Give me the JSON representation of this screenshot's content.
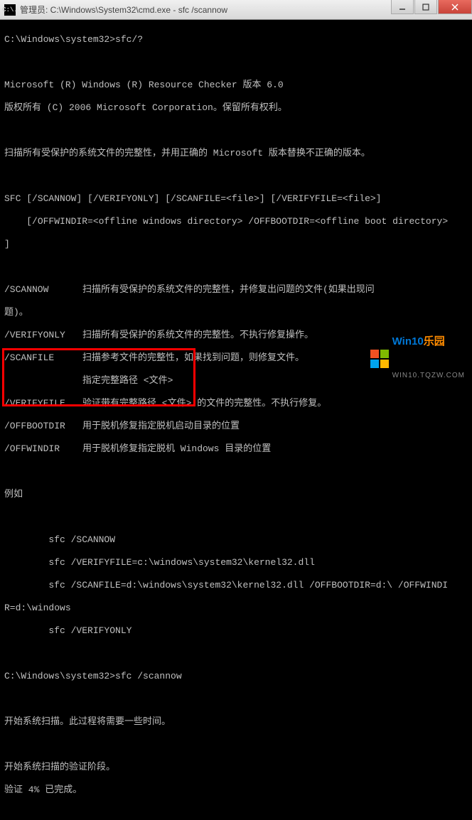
{
  "titlebar": {
    "icon_text": "C:\\.",
    "title": "管理员: C:\\Windows\\System32\\cmd.exe - sfc  /scannow"
  },
  "console": {
    "prompt1": "C:\\Windows\\system32>sfc/?",
    "blank": "",
    "ver_line": "Microsoft (R) Windows (R) Resource Checker 版本 6.0",
    "copyright": "版权所有 (C) 2006 Microsoft Corporation。保留所有权利。",
    "desc1": "扫描所有受保护的系统文件的完整性，并用正确的 Microsoft 版本替换不正确的版本。",
    "syntax1": "SFC [/SCANNOW] [/VERIFYONLY] [/SCANFILE=<file>] [/VERIFYFILE=<file>]",
    "syntax2": "    [/OFFWINDIR=<offline windows directory> /OFFBOOTDIR=<offline boot directory>",
    "syntax3": "]",
    "opt_scannow_k": "/SCANNOW",
    "opt_scannow_v1": "扫描所有受保护的系统文件的完整性，并修复出问题的文件(如果出现问",
    "opt_scannow_v2": "题)。",
    "opt_verifyonly_k": "/VERIFYONLY",
    "opt_verifyonly_v": "扫描所有受保护的系统文件的完整性。不执行修复操作。",
    "opt_scanfile_k": "/SCANFILE",
    "opt_scanfile_v1": "扫描参考文件的完整性，如果找到问题，则修复文件。",
    "opt_scanfile_v2": "指定完整路径 <文件>",
    "opt_verifyfile_k": "/VERIFYFILE",
    "opt_verifyfile_v": "验证带有完整路径 <文件> 的文件的完整性。不执行修复。",
    "opt_offbootdir_k": "/OFFBOOTDIR",
    "opt_offbootdir_v": "用于脱机修复指定脱机启动目录的位置",
    "opt_offwindir_k": "/OFFWINDIR",
    "opt_offwindir_v": "用于脱机修复指定脱机 Windows 目录的位置",
    "example_hdr": "例如",
    "ex1": "        sfc /SCANNOW",
    "ex2": "        sfc /VERIFYFILE=c:\\windows\\system32\\kernel32.dll",
    "ex3": "        sfc /SCANFILE=d:\\windows\\system32\\kernel32.dll /OFFBOOTDIR=d:\\ /OFFWINDI",
    "ex3b": "R=d:\\windows",
    "ex4": "        sfc /VERIFYONLY",
    "prompt2": "C:\\Windows\\system32>sfc /scannow",
    "scan1": "开始系统扫描。此过程将需要一些时间。",
    "scan2": "开始系统扫描的验证阶段。",
    "scan3": "验证 4% 已完成。"
  },
  "watermark": {
    "main_a": "Win10",
    "main_b": "乐园",
    "sub": "WIN10.TQZW.COM"
  }
}
